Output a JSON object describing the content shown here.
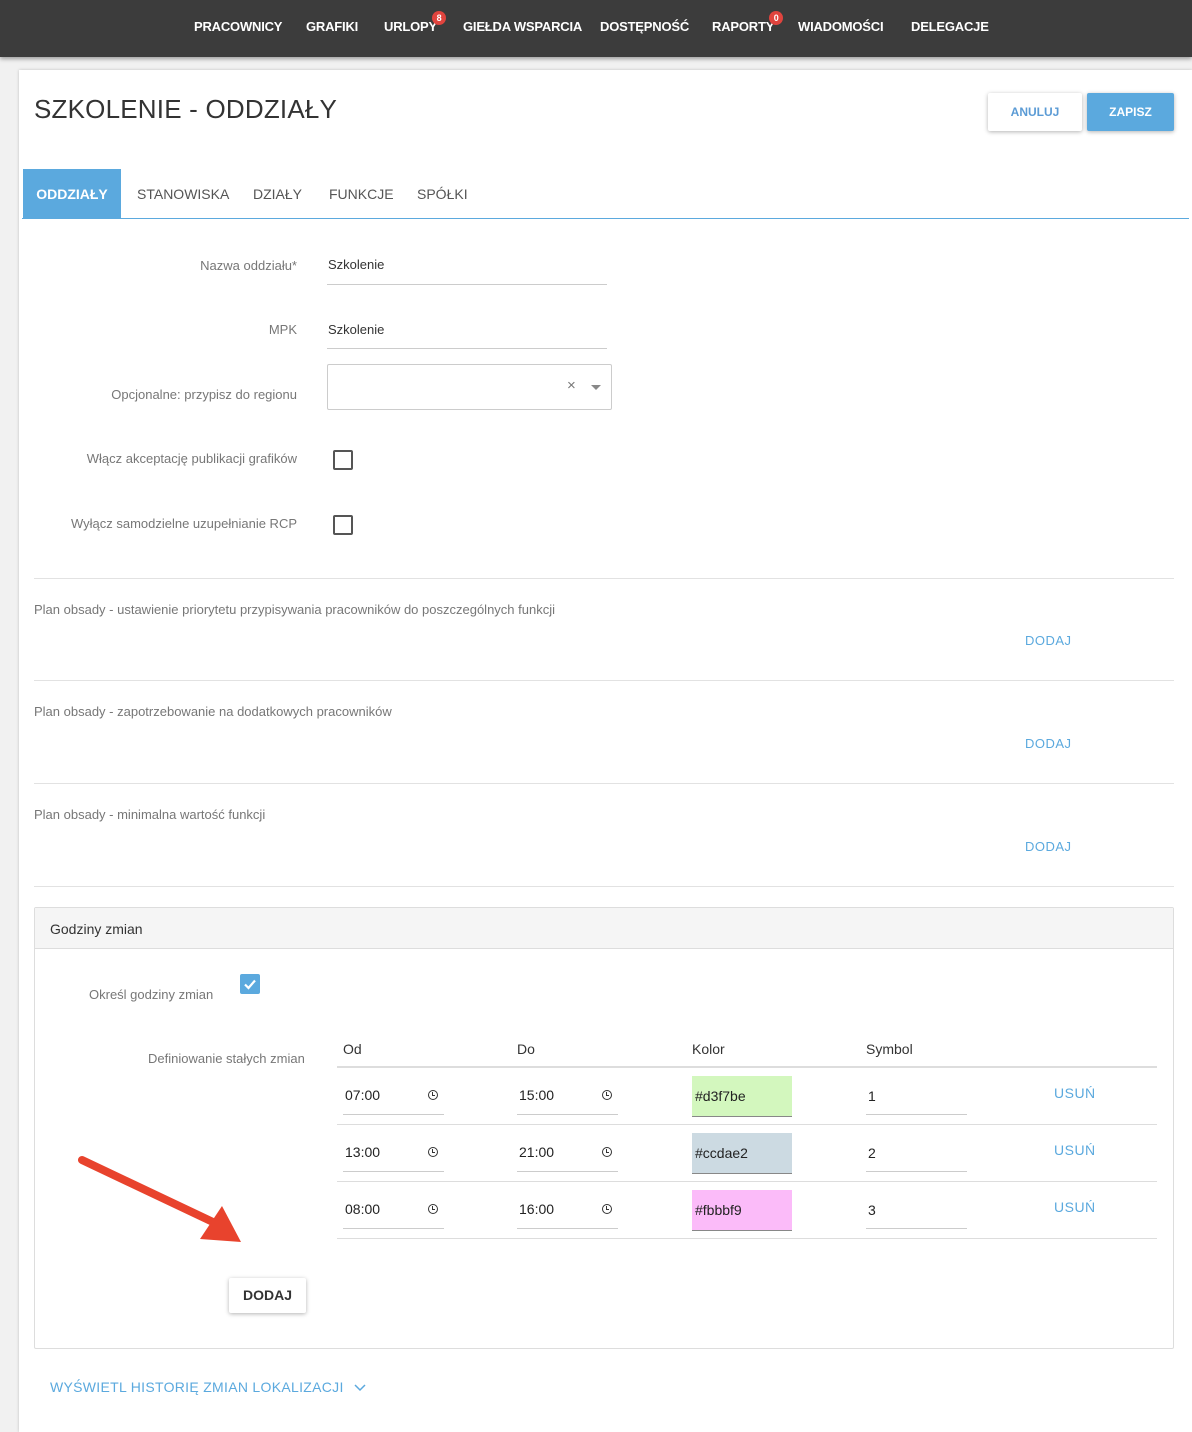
{
  "nav": {
    "items": [
      {
        "label": "PRACOWNICY"
      },
      {
        "label": "GRAFIKI"
      },
      {
        "label": "URLOPY",
        "badge": "8"
      },
      {
        "label": "GIEŁDA WSPARCIA"
      },
      {
        "label": "DOSTĘPNOŚĆ"
      },
      {
        "label": "RAPORTY",
        "badge": "0"
      },
      {
        "label": "WIADOMOŚCI"
      },
      {
        "label": "DELEGACJE"
      }
    ]
  },
  "header": {
    "title": "SZKOLENIE - ODDZIAŁY",
    "cancel_label": "ANULUJ",
    "save_label": "ZAPISZ"
  },
  "tabs": [
    {
      "label": "ODDZIAŁY",
      "active": true
    },
    {
      "label": "STANOWISKA"
    },
    {
      "label": "DZIAŁY"
    },
    {
      "label": "FUNKCJE"
    },
    {
      "label": "SPÓŁKI"
    }
  ],
  "form": {
    "name_label": "Nazwa oddziału*",
    "name_value": "Szkolenie",
    "mpk_label": "MPK",
    "mpk_value": "Szkolenie",
    "region_label": "Opcjonalne: przypisz do regionu",
    "region_value": "",
    "region_clear": "×",
    "accept_label": "Włącz akceptację publikacji grafików",
    "rcp_label": "Wyłącz samodzielne uzupełnianie RCP"
  },
  "plans": [
    {
      "text": "Plan obsady - ustawienie priorytetu przypisywania pracowników do poszczególnych funkcji",
      "action": "DODAJ"
    },
    {
      "text": "Plan obsady - zapotrzebowanie na dodatkowych pracowników",
      "action": "DODAJ"
    },
    {
      "text": "Plan obsady - minimalna wartość funkcji",
      "action": "DODAJ"
    }
  ],
  "shifts": {
    "title": "Godziny zmian",
    "define_label": "Określ godziny zmian",
    "define_checked": true,
    "fixed_label": "Definiowanie stałych zmian",
    "columns": [
      "Od",
      "Do",
      "Kolor",
      "Symbol"
    ],
    "rows": [
      {
        "from": "07:00",
        "to": "15:00",
        "color": "#d3f7be",
        "symbol": "1",
        "remove": "USUŃ"
      },
      {
        "from": "13:00",
        "to": "21:00",
        "color": "#ccdae2",
        "symbol": "2",
        "remove": "USUŃ"
      },
      {
        "from": "08:00",
        "to": "16:00",
        "color": "#fbbbf9",
        "symbol": "3",
        "remove": "USUŃ"
      }
    ],
    "add_label": "DODAJ"
  },
  "history_link": "WYŚWIETL HISTORIĘ ZMIAN LOKALIZACJI",
  "colors": {
    "accent": "#5ba9de",
    "nav_bg": "#3c3c3c",
    "badge": "#e0443e",
    "arrow": "#e8432d"
  }
}
